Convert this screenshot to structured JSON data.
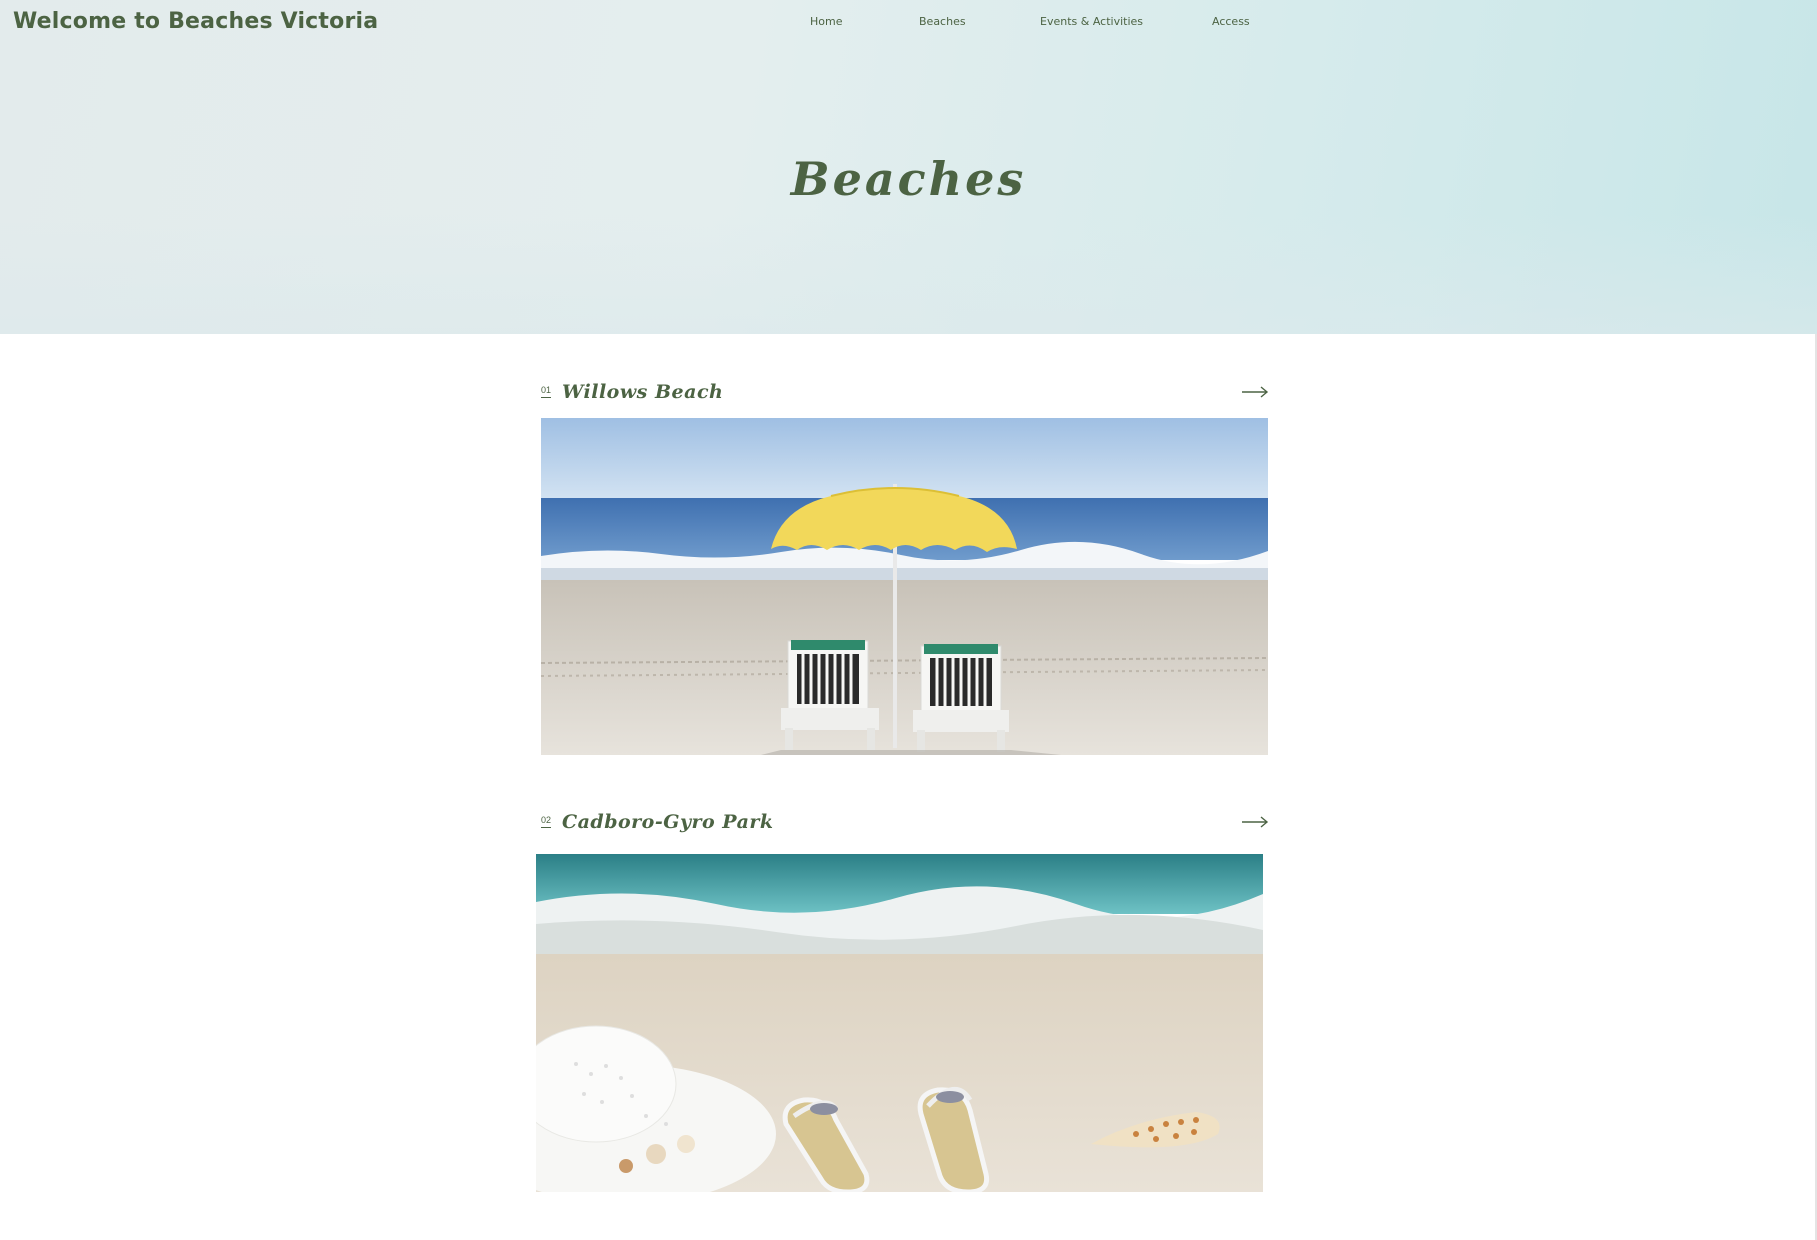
{
  "header": {
    "site_title": "Welcome to Beaches Victoria",
    "nav": [
      "Home",
      "Beaches",
      "Events & Activities",
      "Access"
    ]
  },
  "hero": {
    "heading": "Beaches"
  },
  "beaches": [
    {
      "number": "01",
      "name": "Willows Beach",
      "icon": "arrow-right-icon"
    },
    {
      "number": "02",
      "name": "Cadboro-Gyro Park",
      "icon": "arrow-right-icon"
    }
  ],
  "colors": {
    "accent": "#4c6343",
    "hero_start": "#e3ebec",
    "hero_end": "#c7e6e8"
  }
}
